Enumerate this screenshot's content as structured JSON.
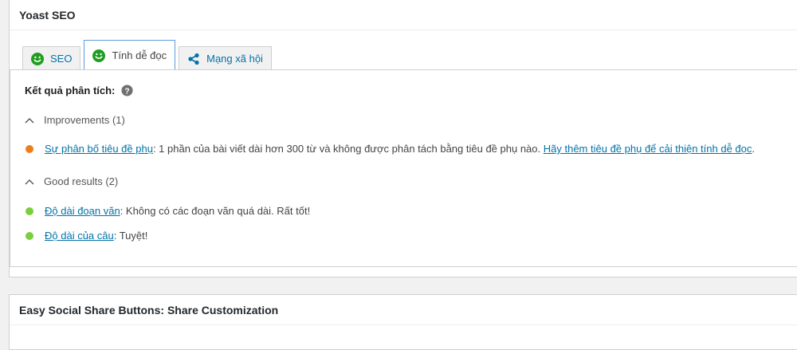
{
  "yoast": {
    "title": "Yoast SEO",
    "tabs": [
      {
        "label": "SEO",
        "icon": "smiley-face-icon",
        "active": false
      },
      {
        "label": "Tính dễ đọc",
        "icon": "smiley-face-icon",
        "active": true
      },
      {
        "label": "Mạng xã hội",
        "icon": "share-icon",
        "active": false
      }
    ],
    "analysis_heading": "Kết quả phân tích:",
    "improvements": {
      "toggle_label": "Improvements (1)",
      "items": [
        {
          "status": "bad",
          "link_text": "Sự phân bố tiêu đề phụ",
          "text": ": 1 phần của bài viết dài hơn 300 từ và không được phân tách bằng tiêu đề phụ nào. ",
          "action_link": "Hãy thêm tiêu đề phụ để cải thiện tính dễ đọc",
          "tail": "."
        }
      ]
    },
    "good_results": {
      "toggle_label": "Good results (2)",
      "items": [
        {
          "status": "good",
          "link_text": "Độ dài đoạn văn",
          "text": ": Không có các đoạn văn quá dài. Rất tốt!"
        },
        {
          "status": "good",
          "link_text": "Độ dài của câu",
          "text": ": Tuyệt!"
        }
      ]
    }
  },
  "ess": {
    "title": "Easy Social Share Buttons: Share Customization"
  },
  "colors": {
    "smiley_green": "#1f9d1f",
    "bullet_bad": "#ee7c1b",
    "bullet_good": "#7ad03a",
    "link": "#0073aa"
  }
}
